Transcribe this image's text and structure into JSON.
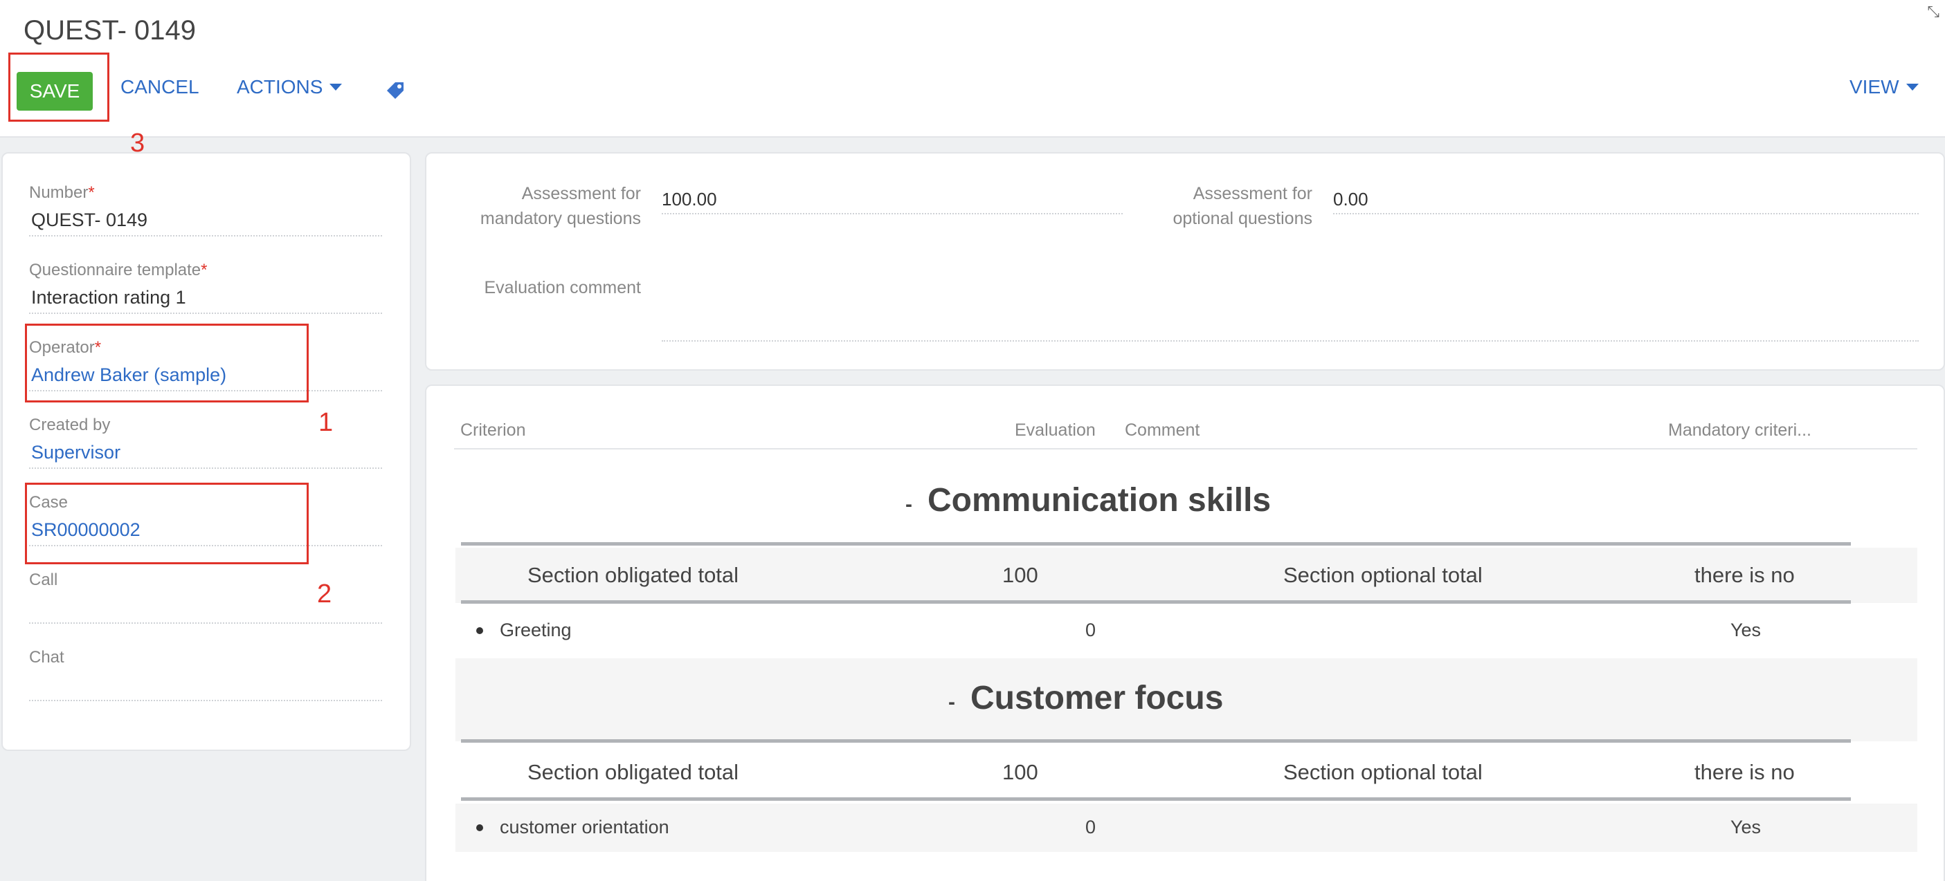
{
  "page": {
    "title": "QUEST- 0149"
  },
  "toolbar": {
    "save_label": "SAVE",
    "cancel_label": "CANCEL",
    "actions_label": "ACTIONS",
    "view_label": "VIEW"
  },
  "annotations": {
    "n1": "1",
    "n2": "2",
    "n3": "3"
  },
  "fields": {
    "number": {
      "label": "Number",
      "value": "QUEST- 0149"
    },
    "template": {
      "label": "Questionnaire template",
      "value": "Interaction rating 1"
    },
    "operator": {
      "label": "Operator",
      "value": "Andrew Baker (sample)"
    },
    "created_by": {
      "label": "Created by",
      "value": "Supervisor"
    },
    "case": {
      "label": "Case",
      "value": "SR00000002"
    },
    "call": {
      "label": "Call",
      "value": ""
    },
    "chat": {
      "label": "Chat",
      "value": ""
    },
    "required_mark": "*"
  },
  "assessment": {
    "mandatory_label_1": "Assessment for",
    "mandatory_label_2": "mandatory questions",
    "mandatory_value": "100.00",
    "optional_label_1": "Assessment for",
    "optional_label_2": "optional questions",
    "optional_value": "0.00",
    "comment_label": "Evaluation comment",
    "comment_value": ""
  },
  "grid": {
    "columns": [
      "Criterion",
      "Evaluation",
      "Comment",
      "Mandatory criteri..."
    ],
    "sections": [
      {
        "toggle": "-",
        "title": "Communication skills",
        "obligated_label": "Section obligated total",
        "obligated_value": "100",
        "optional_label": "Section optional total",
        "optional_value": "there is no",
        "row": {
          "criterion": "Greeting",
          "evaluation": "0",
          "mandatory": "Yes"
        }
      },
      {
        "toggle": "-",
        "title": "Customer focus",
        "obligated_label": "Section obligated total",
        "obligated_value": "100",
        "optional_label": "Section optional total",
        "optional_value": "there is no",
        "row": {
          "criterion": "customer orientation",
          "evaluation": "0",
          "mandatory": "Yes"
        }
      }
    ]
  },
  "colors": {
    "accent": "#2e6bc5",
    "save": "#4caf3c",
    "annotation": "#e0332a"
  },
  "icons": {
    "tag": "tag-icon",
    "caret": "chevron-down-icon",
    "collapse": "collapse-icon"
  }
}
